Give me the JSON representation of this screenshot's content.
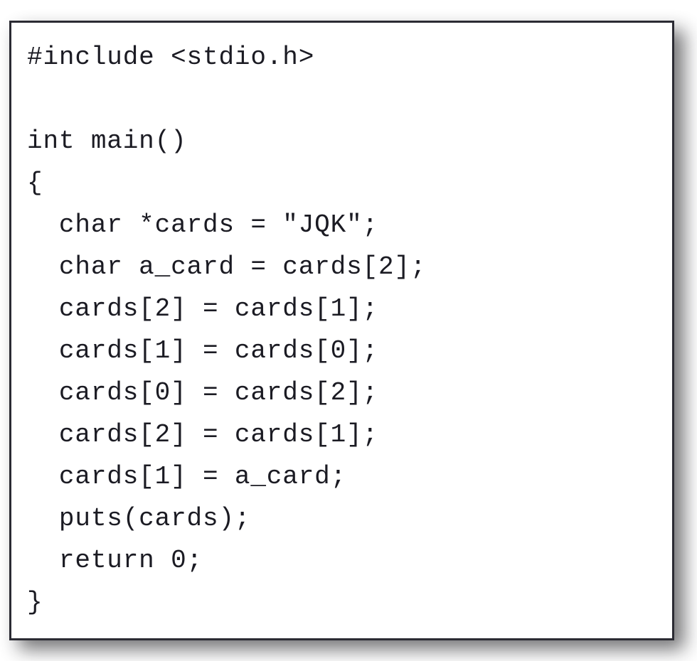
{
  "page": {
    "background_color": "#ffffff",
    "language": "c"
  },
  "code_card": {
    "background_color": "#ffffff",
    "border_color": "#2b2b33",
    "shadow_color": "#6e6e70",
    "text_color": "#1b1b23"
  },
  "code": {
    "lines": [
      {
        "text": "#include <stdio.h>",
        "blank": false
      },
      {
        "text": "",
        "blank": true
      },
      {
        "text": "int main()",
        "blank": false
      },
      {
        "text": "{",
        "blank": false
      },
      {
        "text": "  char *cards = \"JQK\";",
        "blank": false
      },
      {
        "text": "  char a_card = cards[2];",
        "blank": false
      },
      {
        "text": "  cards[2] = cards[1];",
        "blank": false
      },
      {
        "text": "  cards[1] = cards[0];",
        "blank": false
      },
      {
        "text": "  cards[0] = cards[2];",
        "blank": false
      },
      {
        "text": "  cards[2] = cards[1];",
        "blank": false
      },
      {
        "text": "  cards[1] = a_card;",
        "blank": false
      },
      {
        "text": "  puts(cards);",
        "blank": false
      },
      {
        "text": "  return 0;",
        "blank": false
      },
      {
        "text": "}",
        "blank": false
      }
    ]
  }
}
